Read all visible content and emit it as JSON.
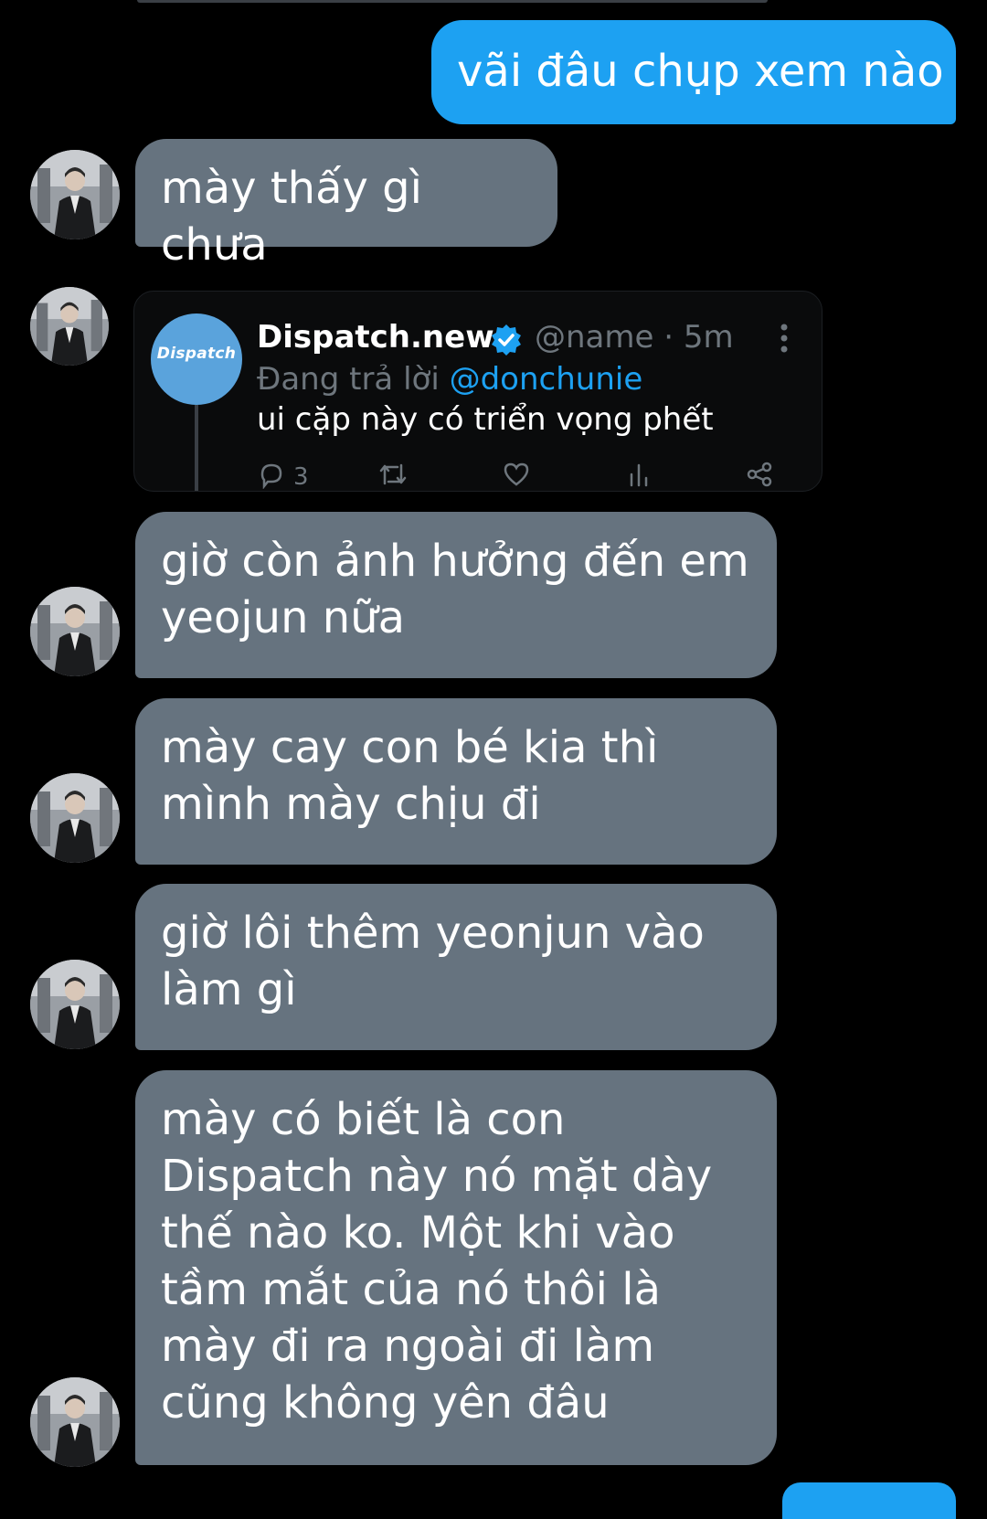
{
  "colors": {
    "background": "#000000",
    "outgoing_bubble": "#1da1f2",
    "incoming_bubble": "#66737f",
    "tweet_card": "#0a0b0c",
    "muted_text": "#6e767d",
    "mention": "#1da1f2"
  },
  "outgoing": {
    "message_1": "vãi đâu chụp xem nào"
  },
  "incoming": {
    "message_1": "mày thấy gì chưa",
    "message_2": "giờ còn ảnh hưởng đến em yeojun nữa",
    "message_3": "mày cay con bé kia thì mình mày chịu đi",
    "message_4": "giờ lôi thêm yeonjun vào làm gì",
    "message_5": "mày có biết là con Dispatch này nó mặt dày thế nào ko. Một khi vào tầm mắt của nó thôi là mày đi ra ngoài đi làm cũng không yên đâu"
  },
  "tweet": {
    "avatar_label": "Dispatch",
    "display_name": "Dispatch.news",
    "verified_icon": "verified-badge-icon",
    "handle_time": "@name · 5m",
    "replying_prefix": "Đang trả lời",
    "replying_to": "@donchunie",
    "body": "ui cặp này có triển vọng phết",
    "reply_count": "3",
    "icons": [
      "reply-icon",
      "retweet-icon",
      "like-icon",
      "analytics-icon",
      "share-icon",
      "more-icon"
    ]
  },
  "avatar_icon": "contact-avatar-icon"
}
